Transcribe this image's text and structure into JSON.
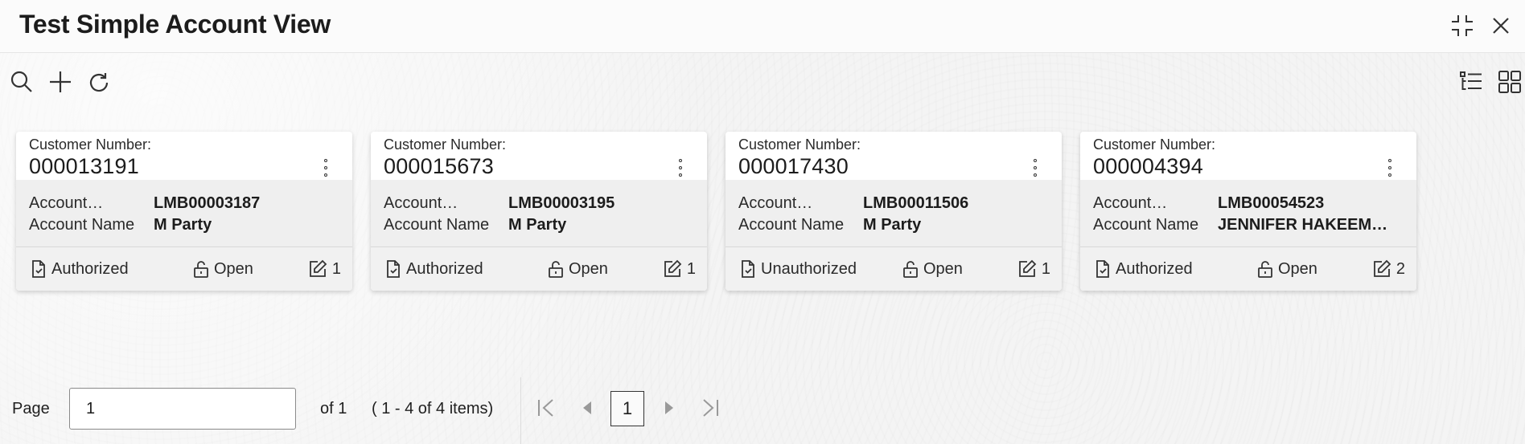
{
  "header": {
    "title": "Test Simple Account View",
    "icons": [
      "collapse-icon",
      "close-icon"
    ]
  },
  "toolbar": {
    "icons": [
      "search-icon",
      "plus-icon",
      "refresh-icon",
      "list-view-icon",
      "grid-view-icon"
    ]
  },
  "cards": [
    {
      "customer_label": "Customer Number:",
      "customer_number": "000013191",
      "account_label": "Account…",
      "account_number": "LMB00003187",
      "name_label": "Account Name",
      "account_name": "M Party",
      "status": "Authorized",
      "lock": "Open",
      "edit_count": "1"
    },
    {
      "customer_label": "Customer Number:",
      "customer_number": "000015673",
      "account_label": "Account…",
      "account_number": "LMB00003195",
      "name_label": "Account Name",
      "account_name": "M Party",
      "status": "Authorized",
      "lock": "Open",
      "edit_count": "1"
    },
    {
      "customer_label": "Customer Number:",
      "customer_number": "000017430",
      "account_label": "Account…",
      "account_number": "LMB00011506",
      "name_label": "Account Name",
      "account_name": "M Party",
      "status": "Unauthorized",
      "lock": "Open",
      "edit_count": "1"
    },
    {
      "customer_label": "Customer Number:",
      "customer_number": "000004394",
      "account_label": "Account…",
      "account_number": "LMB00054523",
      "name_label": "Account Name",
      "account_name": "JENNIFER HAKEEM…",
      "status": "Authorized",
      "lock": "Open",
      "edit_count": "2"
    }
  ],
  "pagination": {
    "page_label": "Page",
    "page_value": "1",
    "of_text": "of 1",
    "items_text": "( 1 - 4 of 4 items)",
    "current_page": "1"
  }
}
